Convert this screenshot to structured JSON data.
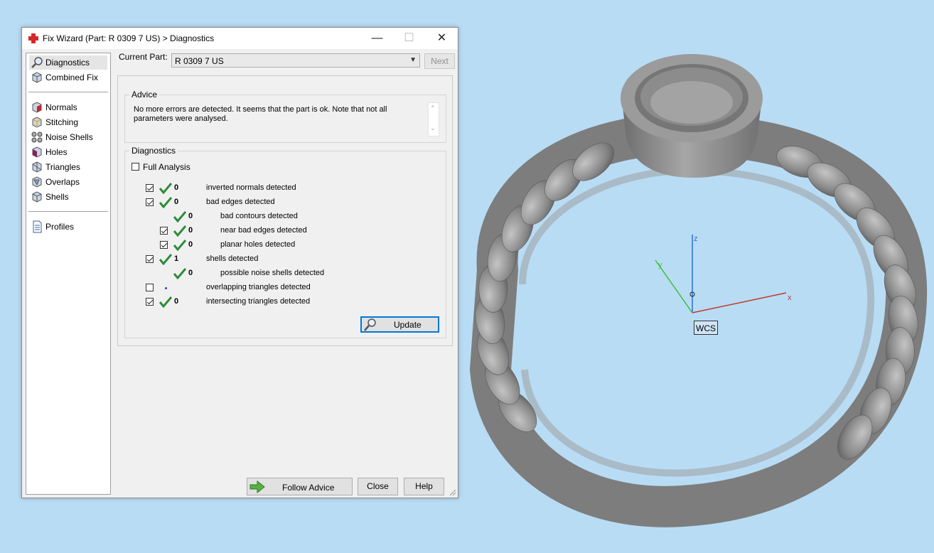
{
  "window": {
    "title": "Fix Wizard (Part: R 0309 7 US) > Diagnostics",
    "controls": {
      "minimize": "—",
      "maximize": "☐",
      "close": "✕"
    }
  },
  "sidebar": {
    "items": [
      {
        "label": "Diagnostics",
        "icon": "magnifier-icon",
        "selected": true
      },
      {
        "label": "Combined Fix",
        "icon": "cube-icon"
      },
      {
        "label": "Normals",
        "icon": "normals-cube-icon"
      },
      {
        "label": "Stitching",
        "icon": "stitching-cube-icon"
      },
      {
        "label": "Noise Shells",
        "icon": "noise-shells-icon"
      },
      {
        "label": "Holes",
        "icon": "holes-cube-icon"
      },
      {
        "label": "Triangles",
        "icon": "triangles-cube-icon"
      },
      {
        "label": "Overlaps",
        "icon": "overlaps-cube-icon"
      },
      {
        "label": "Shells",
        "icon": "shells-cube-icon"
      },
      {
        "label": "Profiles",
        "icon": "document-icon"
      }
    ]
  },
  "current_part": {
    "label": "Current Part:",
    "value": "R 0309 7 US"
  },
  "next_button": "Next",
  "advice": {
    "title": "Advice",
    "text": "No more errors are detected. It seems that the part is ok. Note that not all parameters were analysed."
  },
  "diagnostics": {
    "title": "Diagnostics",
    "full_analysis_label": "Full Analysis",
    "full_analysis_checked": false,
    "rows": [
      {
        "checked": true,
        "has_checkbox": true,
        "status": "ok",
        "value": "0",
        "label": "inverted normals detected",
        "indent": 0
      },
      {
        "checked": true,
        "has_checkbox": true,
        "status": "ok",
        "value": "0",
        "label": "bad edges detected",
        "indent": 0
      },
      {
        "checked": false,
        "has_checkbox": false,
        "status": "ok",
        "value": "0",
        "label": "bad contours detected",
        "indent": 1
      },
      {
        "checked": true,
        "has_checkbox": true,
        "status": "ok",
        "value": "0",
        "label": "near bad edges detected",
        "indent": 1
      },
      {
        "checked": true,
        "has_checkbox": true,
        "status": "ok",
        "value": "0",
        "label": "planar holes detected",
        "indent": 1
      },
      {
        "checked": true,
        "has_checkbox": true,
        "status": "ok",
        "value": "1",
        "label": "shells detected",
        "indent": 0
      },
      {
        "checked": false,
        "has_checkbox": false,
        "status": "ok",
        "value": "0",
        "label": "possible noise shells detected",
        "indent": 1
      },
      {
        "checked": false,
        "has_checkbox": true,
        "status": "dot",
        "value": "",
        "label": "overlapping triangles detected",
        "indent": 0
      },
      {
        "checked": true,
        "has_checkbox": true,
        "status": "ok",
        "value": "0",
        "label": "intersecting triangles detected",
        "indent": 0
      }
    ]
  },
  "buttons": {
    "update": "Update",
    "follow_advice": "Follow Advice",
    "close": "Close",
    "help": "Help"
  },
  "viewport": {
    "axes": {
      "z": "z",
      "y": "y",
      "x": "x"
    },
    "wcs_label": "WCS",
    "colors": {
      "background": "#b9dcf5",
      "x_axis": "#c0392b",
      "y_axis": "#3bbf3b",
      "z_axis": "#2a6fd6",
      "ring": "#8a8a8a"
    }
  }
}
